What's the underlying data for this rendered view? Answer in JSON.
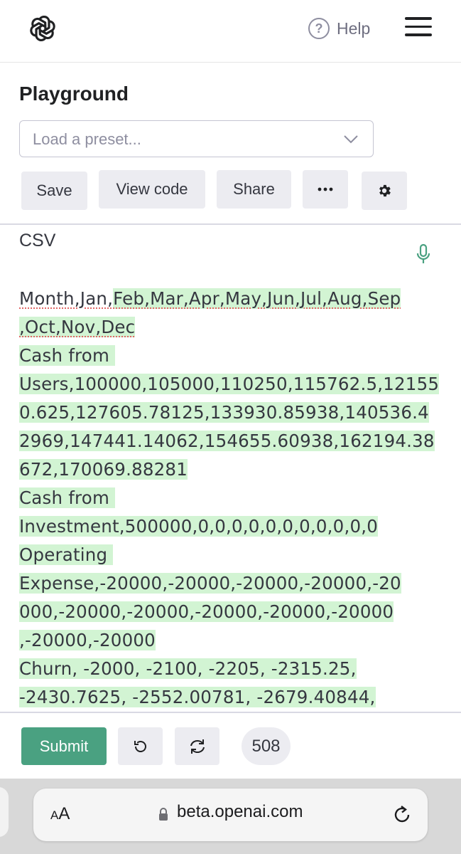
{
  "nav": {
    "help_label": "Help",
    "help_icon": "question-circle-icon",
    "menu_icon": "hamburger-menu-icon",
    "logo_icon": "openai-logo-icon"
  },
  "page": {
    "title": "Playground"
  },
  "preset": {
    "placeholder": "Load a preset..."
  },
  "toolbar": {
    "save_label": "Save",
    "view_code_label": "View code",
    "share_label": "Share",
    "more_label": "···",
    "settings_icon": "gear-icon"
  },
  "editor": {
    "prompt_text": "CSV",
    "completion_lines": [
      "Month,Jan,Feb,Mar,Apr,May,Jun,Jul,Aug,Sep",
      ",Oct,Nov,Dec",
      "Cash from ",
      "Users,100000,105000,110250,115762.5,12155",
      "0.625,127605.78125,133930.85938,140536.4",
      "2969,147441.14062,154655.60938,162194.38",
      "672,170069.88281",
      "Cash from ",
      "Investment,500000,0,0,0,0,0,0,0,0,0,0,0",
      "Operating ",
      "Expense,-20000,-20000,-20000,-20000,-20",
      "000,-20000,-20000,-20000,-20000,-20000",
      ",-20000,-20000",
      "Churn, -2000, -2100, -2205, -2315.25,",
      "-2430.7625, -2552.00781, -2679.40844,"
    ],
    "highlight_color": "#d2f4d3"
  },
  "actions": {
    "submit_label": "Submit",
    "token_count": "508",
    "submit_color": "#4aa181"
  },
  "browser": {
    "text_size_label_small": "A",
    "text_size_label_large": "A",
    "url": "beta.openai.com"
  }
}
